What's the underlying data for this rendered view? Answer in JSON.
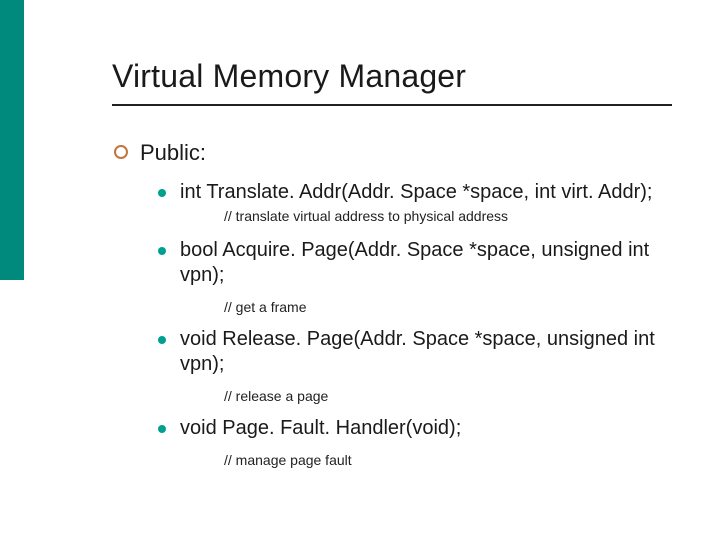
{
  "title": "Virtual Memory Manager",
  "section": {
    "label": "Public:"
  },
  "items": [
    {
      "code": "int Translate. Addr(Addr. Space *space, int virt. Addr);",
      "comment": "// translate virtual address to physical address"
    },
    {
      "code": "bool Acquire. Page(Addr. Space *space, unsigned int vpn);",
      "comment": "// get a frame"
    },
    {
      "code": "void Release. Page(Addr. Space *space, unsigned int vpn);",
      "comment": "// release a page"
    },
    {
      "code": "void Page. Fault. Handler(void);",
      "comment": "// manage page fault"
    }
  ]
}
